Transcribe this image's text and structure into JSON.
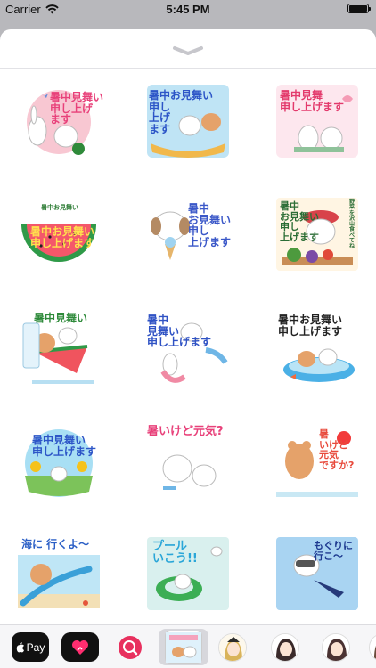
{
  "status_bar": {
    "carrier": "Carrier",
    "time": "5:45 PM"
  },
  "stickers": [
    {
      "text": "暑中見舞い\n申し上げ\nます"
    },
    {
      "text": "暑中お見舞い\n申し\n上げ\nます"
    },
    {
      "text": "暑中見舞\n申し上げます"
    },
    {
      "text": "暑中お見舞い\n申し上げます",
      "small": "暑中お見舞い"
    },
    {
      "text": "暑中\nお見舞い\n申し\n上げます"
    },
    {
      "text": "暑中\nお見舞い\n申し\n上げます",
      "side": "野菜を沢山食べてね"
    },
    {
      "text": "暑中見舞い"
    },
    {
      "text": "暑中\n見舞い\n申し上げます"
    },
    {
      "text": "暑中お見舞い\n申し上げます"
    },
    {
      "text": "暑中見舞い\n申し上げます"
    },
    {
      "text": "暑いけど元気?"
    },
    {
      "text": "暑\nいけど\n元気\nですか?"
    },
    {
      "text": "海に 行くよ〜"
    },
    {
      "text": "プール\nいこう!!"
    },
    {
      "text": "もぐりに\n行こ〜"
    }
  ],
  "app_drawer": {
    "apple_pay_label": "Pay",
    "icons": [
      "apple-pay-icon",
      "heart-icon",
      "search-globe-icon"
    ]
  },
  "colors": {
    "sheet_bg": "#ffffff",
    "dim_bg": "#b8b8bc",
    "accent_pink": "#e8417a"
  }
}
